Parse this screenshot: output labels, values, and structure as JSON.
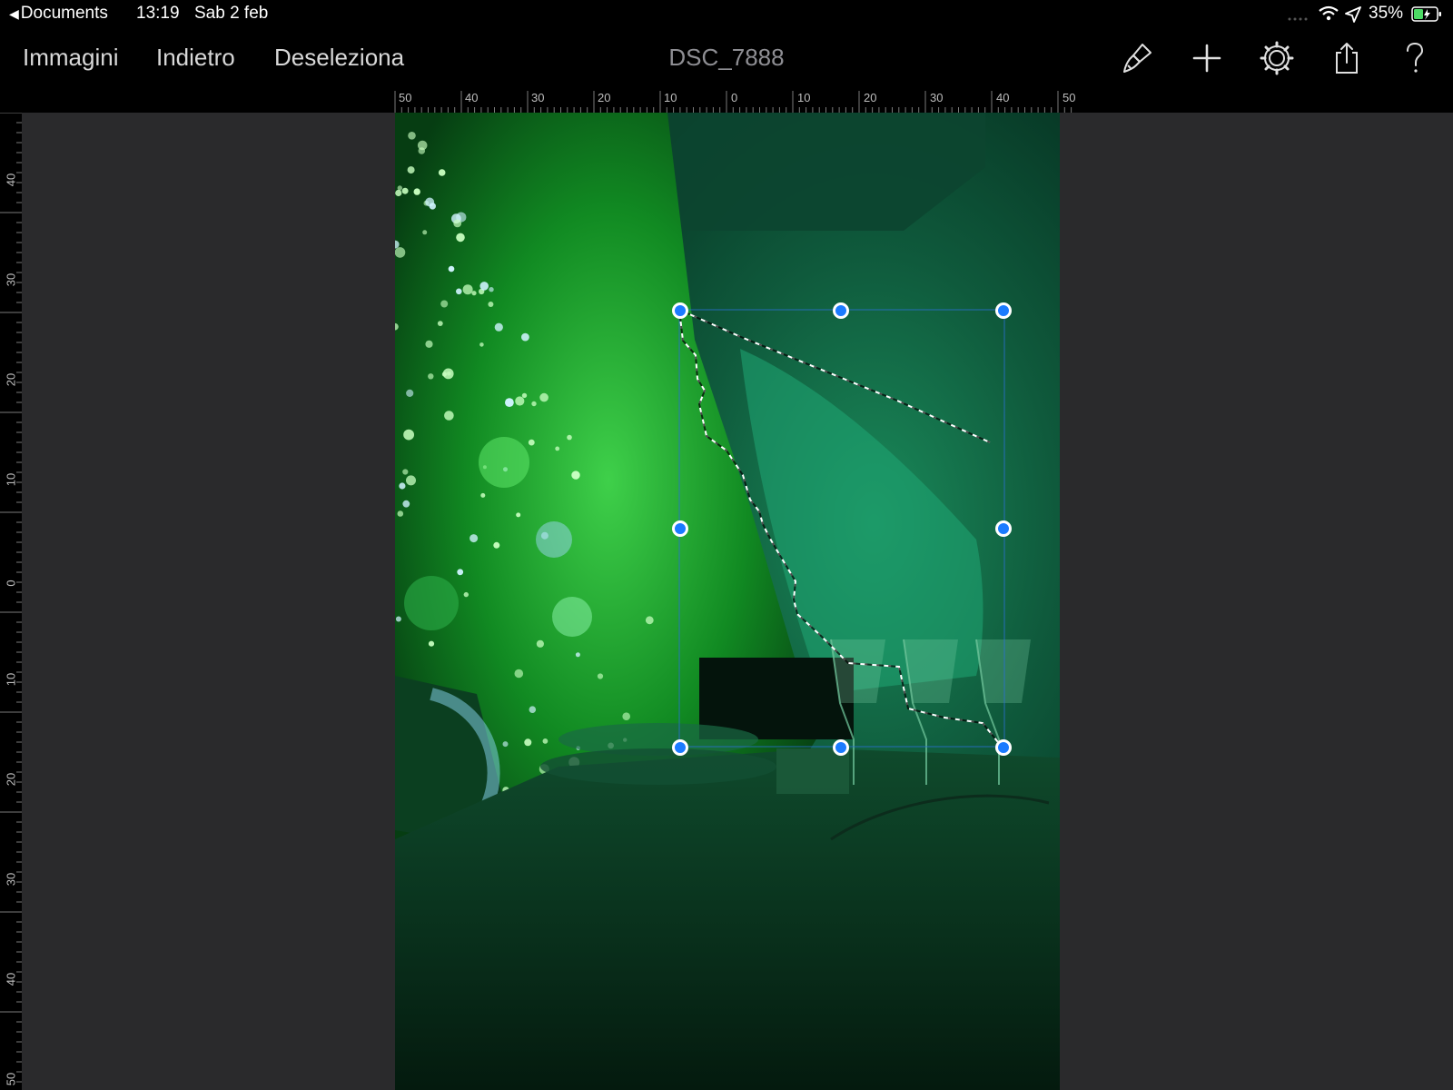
{
  "status": {
    "back_app": "Documents",
    "time": "13:19",
    "date": "Sab 2 feb",
    "battery_percent": "35%"
  },
  "toolbar": {
    "images_label": "Immagini",
    "undo_label": "Indietro",
    "deselect_label": "Deseleziona",
    "document_title": "DSC_7888"
  },
  "icons": {
    "back": "chevron-left-icon",
    "brush": "brush-icon",
    "add": "plus-icon",
    "settings": "gear-icon",
    "share": "share-icon",
    "help": "question-icon",
    "wifi": "wifi-icon",
    "location": "location-icon",
    "battery": "battery-icon"
  },
  "rulers": {
    "horizontal": [
      "50",
      "40",
      "30",
      "20",
      "10",
      "0",
      "10",
      "20",
      "30",
      "40",
      "50"
    ],
    "vertical": [
      "40",
      "30",
      "20",
      "10",
      "0",
      "10",
      "20",
      "30",
      "40",
      "50"
    ]
  },
  "colors": {
    "selection_handle": "#1b7bff",
    "bar_background": "#000000",
    "canvas_background": "#2a2a2c"
  }
}
